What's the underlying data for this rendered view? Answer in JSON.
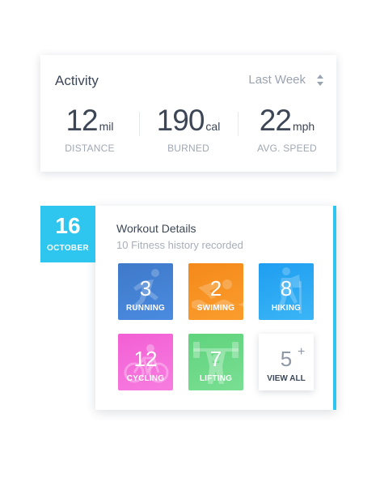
{
  "activity": {
    "title": "Activity",
    "period": "Last Week",
    "stats": [
      {
        "value": "12",
        "unit": "mil",
        "label": "DISTANCE"
      },
      {
        "value": "190",
        "unit": "cal",
        "label": "BURNED"
      },
      {
        "value": "22",
        "unit": "mph",
        "label": "AVG. SPEED"
      }
    ]
  },
  "date": {
    "day": "16",
    "month": "OCTOBER",
    "color": "#2ec6ef"
  },
  "workout": {
    "title": "Workout Details",
    "subtitle": "10 Fitness history recorded",
    "tiles": [
      {
        "count": "3",
        "label": "RUNNING",
        "icon": "running-icon"
      },
      {
        "count": "2",
        "label": "SWIMING",
        "icon": "swimming-icon"
      },
      {
        "count": "8",
        "label": "HIKING",
        "icon": "hiking-icon"
      },
      {
        "count": "12",
        "label": "CYCLING",
        "icon": "cycling-icon"
      },
      {
        "count": "7",
        "label": "LIFTING",
        "icon": "lifting-icon"
      }
    ],
    "view_all": {
      "count": "5",
      "plus": "+",
      "label": "VIEW ALL"
    }
  }
}
